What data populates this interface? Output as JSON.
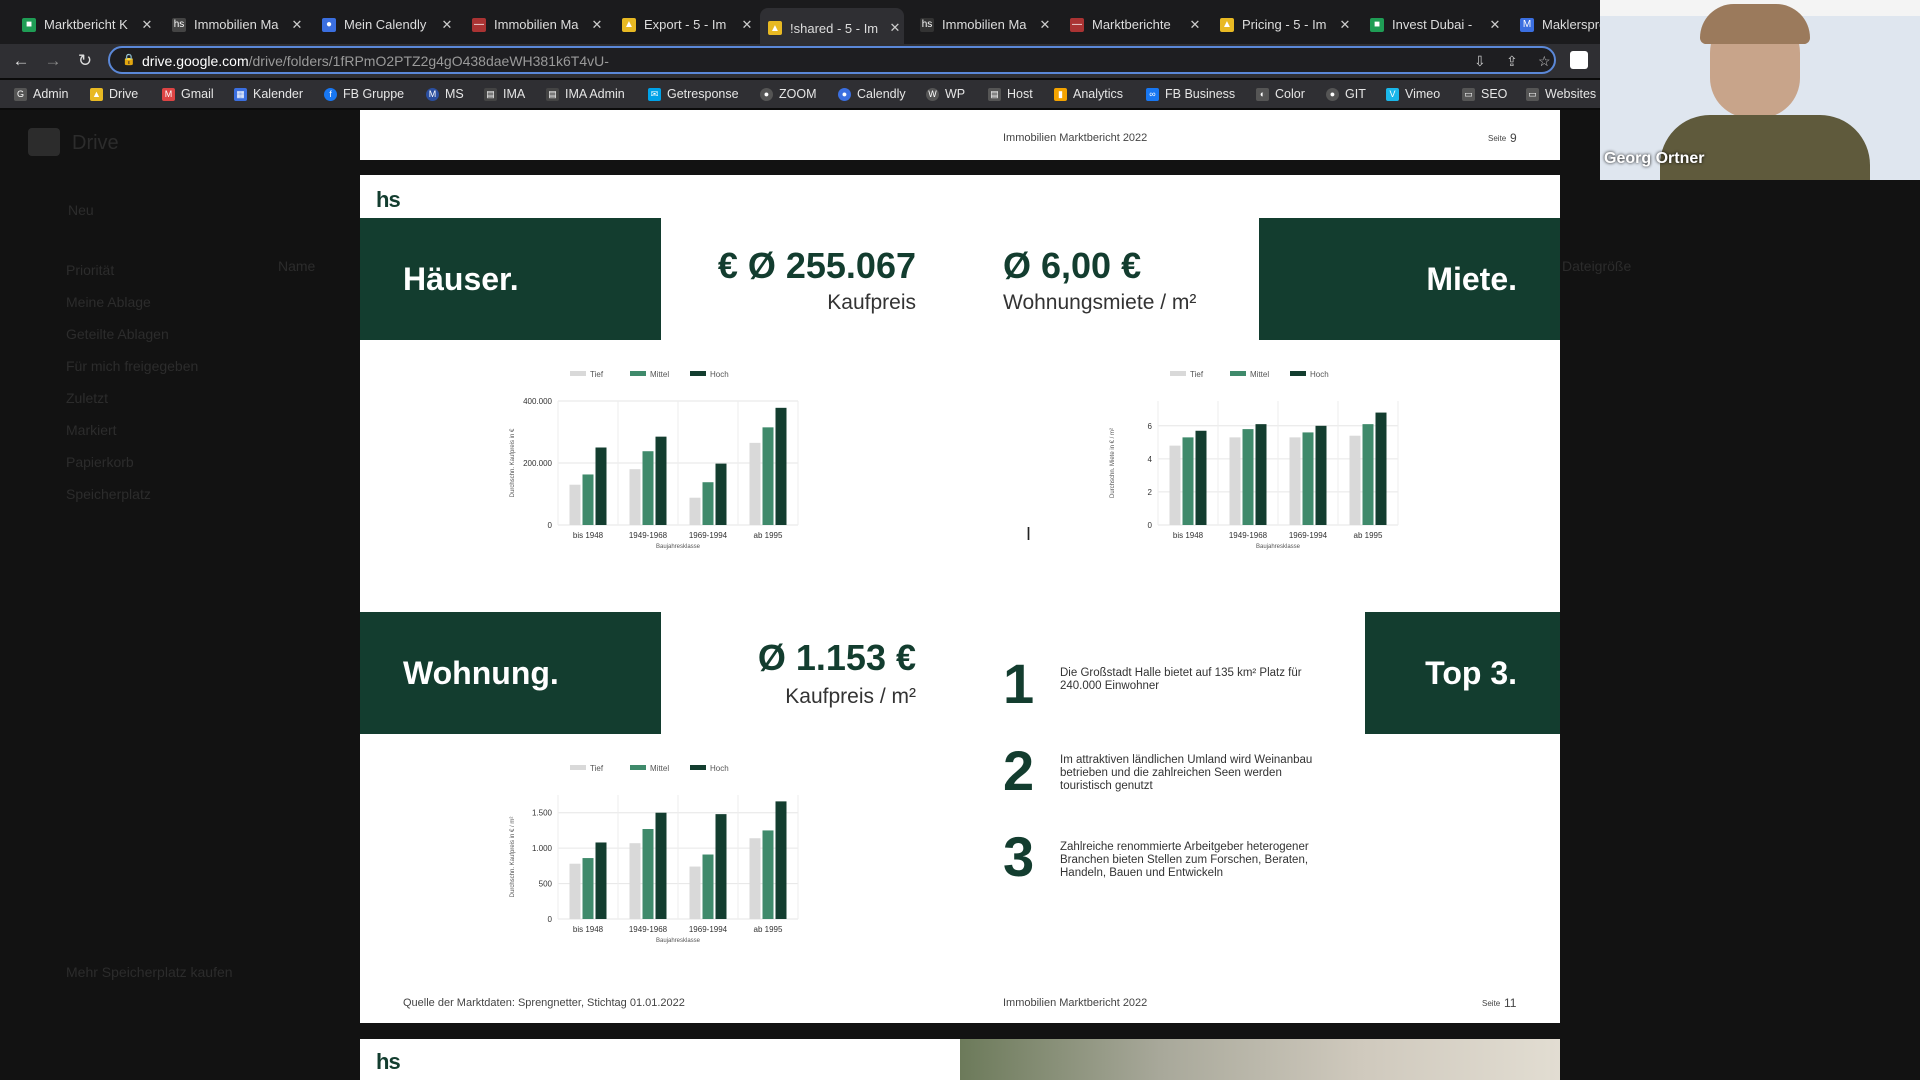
{
  "tabs": [
    {
      "title": "Marktbericht K",
      "color": "#1f9d55",
      "glyph": "■"
    },
    {
      "title": "Immobilien Ma",
      "color": "#444",
      "glyph": "hs"
    },
    {
      "title": "Mein Calendly",
      "color": "#3b6fe0",
      "glyph": "●"
    },
    {
      "title": "Immobilien Ma",
      "color": "#a33",
      "glyph": "—"
    },
    {
      "title": "Export - 5 - Im",
      "color": "#e8b923",
      "glyph": "▲"
    },
    {
      "title": "!shared - 5 - Im",
      "color": "#e8b923",
      "glyph": "▲"
    },
    {
      "title": "Immobilien Ma",
      "color": "#333",
      "glyph": "hs"
    },
    {
      "title": "Marktberichte",
      "color": "#a33",
      "glyph": "—"
    },
    {
      "title": "Pricing - 5 - Im",
      "color": "#e8b923",
      "glyph": "▲"
    },
    {
      "title": "Invest Dubai -",
      "color": "#1f9d55",
      "glyph": "■"
    },
    {
      "title": "Maklerspre",
      "color": "#3b6fe0",
      "glyph": "M"
    }
  ],
  "address": {
    "domain": "drive.google.com",
    "path": "/drive/folders/1fRPmO2PTZ2g4gO438daeWH381k6T4vU-"
  },
  "bookmarks": [
    {
      "label": "Admin",
      "color": "#555"
    },
    {
      "label": "Drive",
      "color": "#e8b923"
    },
    {
      "label": "Gmail",
      "color": "#d44"
    },
    {
      "label": "Kalender",
      "color": "#3b6fe0"
    },
    {
      "label": "FB Gruppe",
      "color": "#1877f2"
    },
    {
      "label": "MS",
      "color": "#2b4fa0"
    },
    {
      "label": "IMA",
      "color": "#444"
    },
    {
      "label": "IMA Admin",
      "color": "#444"
    },
    {
      "label": "Getresponse",
      "color": "#00a2e8"
    },
    {
      "label": "ZOOM",
      "color": "#555"
    },
    {
      "label": "Calendly",
      "color": "#3b6fe0"
    },
    {
      "label": "WP",
      "color": "#555"
    },
    {
      "label": "Host",
      "color": "#555"
    },
    {
      "label": "Analytics",
      "color": "#f4a300"
    },
    {
      "label": "FB Business",
      "color": "#1877f2"
    },
    {
      "label": "Color",
      "color": "#555"
    },
    {
      "label": "GIT",
      "color": "#555"
    },
    {
      "label": "Vimeo",
      "color": "#1ab7ea"
    },
    {
      "label": "SEO",
      "color": "#555"
    },
    {
      "label": "Websites",
      "color": "#555"
    }
  ],
  "drive": {
    "logo": "Drive",
    "new_label": "Neu",
    "sidebar": [
      "Priorität",
      "Meine Ablage",
      "Geteilte Ablagen",
      "Für mich freigegeben",
      "Zuletzt",
      "Markiert",
      "Papierkorb",
      "Speicherplatz"
    ],
    "storage_text": "Mehr Speicherplatz kaufen",
    "column_name": "Name",
    "column_size": "Dateigröße"
  },
  "prev_page": {
    "footer": "Immobilien Marktbericht 2022",
    "seite_label": "Seite",
    "seite_num": "9"
  },
  "slide": {
    "logo": "hs",
    "haeuser": {
      "label": "Häuser.",
      "price": "Ø 255.067 €",
      "price_sub": "Kaufpreis"
    },
    "miete": {
      "label": "Miete.",
      "price": "Ø 6,00 €",
      "price_sub": "Wohnungsmiete / m²"
    },
    "wohnung": {
      "label": "Wohnung.",
      "price": "Ø 1.153 €",
      "price_sub": "Kaufpreis / m²"
    },
    "top3": {
      "label": "Top 3.",
      "items": [
        {
          "n": "1",
          "text": "Die Großstadt Halle bietet auf 135 km² Platz für 240.000 Einwohner"
        },
        {
          "n": "2",
          "text": "Im attraktiven ländlichen Umland wird Weinanbau betrieben und die zahlreichen Seen werden touristisch genutzt"
        },
        {
          "n": "3",
          "text": "Zahlreiche renommierte Arbeitgeber heterogener Branchen bieten Stellen zum Forschen, Beraten, Handeln, Bauen und Entwickeln"
        }
      ]
    },
    "source": "Quelle der Marktdaten: Sprengnetter, Stichtag 01.01.2022",
    "footer": "Immobilien Marktbericht 2022",
    "seite_label": "Seite",
    "seite_num": "11"
  },
  "next_page": {
    "logo": "hs"
  },
  "video": {
    "name": "Georg Ortner"
  },
  "chart_data": [
    {
      "type": "bar",
      "categories": [
        "bis 1948",
        "1949-1968",
        "1969-1994",
        "ab 1995"
      ],
      "series": [
        {
          "name": "Tief",
          "values": [
            130000,
            180000,
            88000,
            265000
          ],
          "color": "#d9d9d9"
        },
        {
          "name": "Mittel",
          "values": [
            163000,
            238000,
            138000,
            315000
          ],
          "color": "#3f8a6b"
        },
        {
          "name": "Hoch",
          "values": [
            250000,
            285000,
            198000,
            378000
          ],
          "color": "#133d2f"
        }
      ],
      "xlabel": "Baujahresklasse",
      "ylabel": "Durchschn. Kaufpreis in €",
      "yticks": [
        "0",
        "200.000",
        "400.000"
      ],
      "ylim": [
        0,
        400000
      ],
      "legend": "top"
    },
    {
      "type": "bar",
      "categories": [
        "bis 1948",
        "1949-1968",
        "1969-1994",
        "ab 1995"
      ],
      "series": [
        {
          "name": "Tief",
          "values": [
            4.8,
            5.3,
            5.3,
            5.4
          ],
          "color": "#d9d9d9"
        },
        {
          "name": "Mittel",
          "values": [
            5.3,
            5.8,
            5.6,
            6.1
          ],
          "color": "#3f8a6b"
        },
        {
          "name": "Hoch",
          "values": [
            5.7,
            6.1,
            6.0,
            6.8
          ],
          "color": "#133d2f"
        }
      ],
      "xlabel": "Baujahresklasse",
      "ylabel": "Durchschn. Miete in € / m²",
      "yticks": [
        "0",
        "2",
        "4",
        "6"
      ],
      "ylim": [
        0,
        7.5
      ],
      "legend": "top"
    },
    {
      "type": "bar",
      "categories": [
        "bis 1948",
        "1949-1968",
        "1969-1994",
        "ab 1995"
      ],
      "series": [
        {
          "name": "Tief",
          "values": [
            780,
            1070,
            740,
            1140
          ],
          "color": "#d9d9d9"
        },
        {
          "name": "Mittel",
          "values": [
            860,
            1270,
            910,
            1250
          ],
          "color": "#3f8a6b"
        },
        {
          "name": "Hoch",
          "values": [
            1080,
            1500,
            1480,
            1660
          ],
          "color": "#133d2f"
        }
      ],
      "xlabel": "Baujahresklasse",
      "ylabel": "Durchschn. Kaufpreis in € / m²",
      "yticks": [
        "0",
        "500",
        "1.000",
        "1.500"
      ],
      "ylim": [
        0,
        1750
      ],
      "legend": "top"
    }
  ]
}
